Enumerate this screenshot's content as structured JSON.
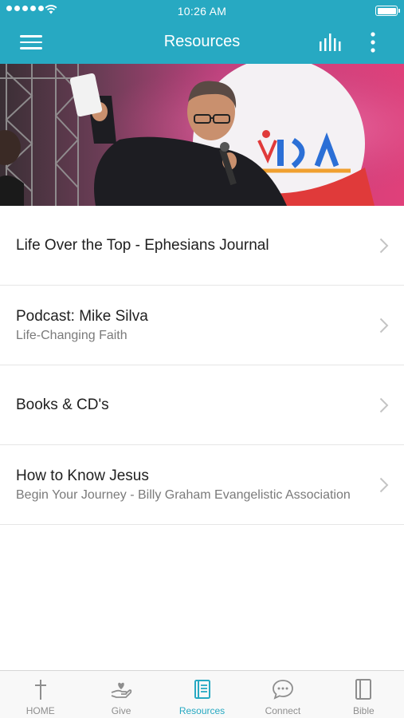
{
  "status_bar": {
    "time": "10:26 AM"
  },
  "header": {
    "title": "Resources",
    "background_color": "#27a9c2"
  },
  "resources": [
    {
      "title": "Life Over the Top - Ephesians Journal",
      "subtitle": ""
    },
    {
      "title": "Podcast: Mike Silva",
      "subtitle": "Life-Changing Faith"
    },
    {
      "title": "Books & CD's",
      "subtitle": ""
    },
    {
      "title": "How to Know Jesus",
      "subtitle": "Begin Your Journey - Billy Graham Evangelistic Association"
    }
  ],
  "tab_bar": {
    "active_color": "#27a9c2",
    "tabs": [
      {
        "label": "HOME",
        "icon": "cross-icon",
        "active": false
      },
      {
        "label": "Give",
        "icon": "give-hand-heart-icon",
        "active": false
      },
      {
        "label": "Resources",
        "icon": "book-icon",
        "active": true
      },
      {
        "label": "Connect",
        "icon": "chat-bubble-icon",
        "active": false
      },
      {
        "label": "Bible",
        "icon": "bible-icon",
        "active": false
      }
    ]
  }
}
